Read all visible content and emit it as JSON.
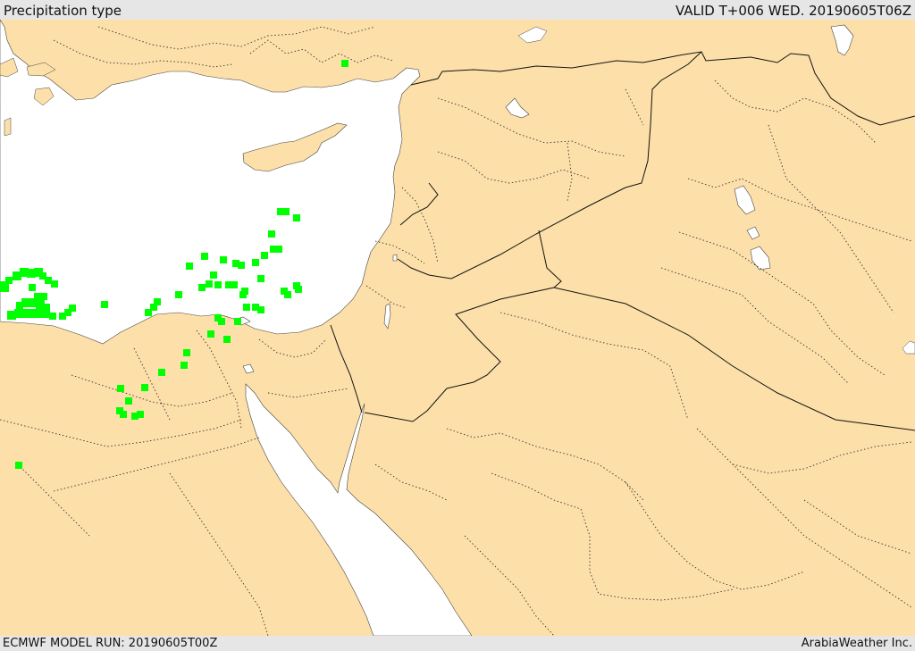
{
  "header": {
    "title": "Precipitation type",
    "valid": "VALID T+006 WED. 20190605T06Z"
  },
  "footer": {
    "model_run": "ECMWF MODEL RUN: 20190605T00Z",
    "credit": "ArabiaWeather Inc."
  },
  "colors": {
    "land": "#fde0a9",
    "sea": "#ffffff",
    "rain": "#00ff00",
    "border": "#111111"
  },
  "legend": {
    "rain_icon": "green-square-icon"
  }
}
